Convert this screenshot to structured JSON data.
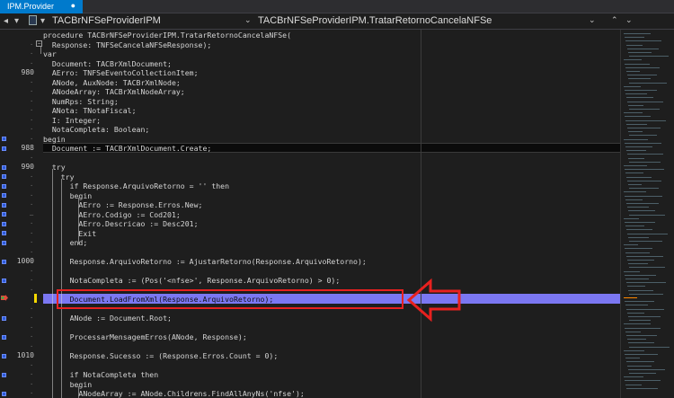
{
  "tab": {
    "title": "IPM.Provider",
    "close": "●"
  },
  "nav": {
    "left": "TACBrNFSeProviderIPM",
    "right": "TACBrNFSeProviderIPM.TratarRetornoCancelaNFSe"
  },
  "code_lines": [
    {
      "ln": "",
      "dot": "",
      "text": "procedure TACBrNFSeProviderIPM.TratarRetornoCancelaNFSe("
    },
    {
      "ln": "",
      "dot": "·",
      "text": "  Response: TNFSeCancelaNFSeResponse);"
    },
    {
      "ln": "",
      "dot": "·",
      "text": "var"
    },
    {
      "ln": "",
      "dot": "·",
      "text": "  Document: TACBrXmlDocument;"
    },
    {
      "ln": "980",
      "dot": "",
      "text": "  AErro: TNFSeEventoCollectionItem;"
    },
    {
      "ln": "",
      "dot": "·",
      "text": "  ANode, AuxNode: TACBrXmlNode;"
    },
    {
      "ln": "",
      "dot": "·",
      "text": "  ANodeArray: TACBrXmlNodeArray;"
    },
    {
      "ln": "",
      "dot": "·",
      "text": "  NumRps: String;"
    },
    {
      "ln": "",
      "dot": "·",
      "text": "  ANota: TNotaFiscal;"
    },
    {
      "ln": "",
      "dot": "·",
      "text": "  I: Integer;"
    },
    {
      "ln": "",
      "dot": "·",
      "text": "  NotaCompleta: Boolean;"
    },
    {
      "ln": "",
      "dot": "·",
      "text": "begin"
    },
    {
      "ln": "988",
      "dot": "",
      "text": "  Document := TACBrXmlDocument.Create;"
    },
    {
      "ln": "",
      "dot": "·",
      "text": ""
    },
    {
      "ln": "990",
      "dot": "",
      "text": "  try"
    },
    {
      "ln": "",
      "dot": "·",
      "text": "    try"
    },
    {
      "ln": "",
      "dot": "·",
      "text": "      if Response.ArquivoRetorno = '' then"
    },
    {
      "ln": "",
      "dot": "·",
      "text": "      begin"
    },
    {
      "ln": "",
      "dot": "·",
      "text": "        AErro := Response.Erros.New;"
    },
    {
      "ln": "",
      "dot": "–",
      "text": "        AErro.Codigo := Cod201;"
    },
    {
      "ln": "",
      "dot": "·",
      "text": "        AErro.Descricao := Desc201;"
    },
    {
      "ln": "",
      "dot": "·",
      "text": "        Exit"
    },
    {
      "ln": "",
      "dot": "·",
      "text": "      end;"
    },
    {
      "ln": "",
      "dot": "·",
      "text": ""
    },
    {
      "ln": "1000",
      "dot": "",
      "text": "      Response.ArquivoRetorno := AjustarRetorno(Response.ArquivoRetorno);"
    },
    {
      "ln": "",
      "dot": "·",
      "text": ""
    },
    {
      "ln": "",
      "dot": "·",
      "text": "      NotaCompleta := (Pos('<nfse>', Response.ArquivoRetorno) > 0);"
    },
    {
      "ln": "",
      "dot": "·",
      "text": ""
    },
    {
      "ln": "",
      "dot": "",
      "text": "      Document.LoadFromXml(Response.ArquivoRetorno);"
    },
    {
      "ln": "",
      "dot": "·",
      "text": ""
    },
    {
      "ln": "",
      "dot": "·",
      "text": "      ANode := Document.Root;"
    },
    {
      "ln": "",
      "dot": "·",
      "text": ""
    },
    {
      "ln": "",
      "dot": "·",
      "text": "      ProcessarMensagemErros(ANode, Response);"
    },
    {
      "ln": "",
      "dot": "·",
      "text": ""
    },
    {
      "ln": "1010",
      "dot": "",
      "text": "      Response.Sucesso := (Response.Erros.Count = 0);"
    },
    {
      "ln": "",
      "dot": "·",
      "text": ""
    },
    {
      "ln": "",
      "dot": "·",
      "text": "      if NotaCompleta then"
    },
    {
      "ln": "",
      "dot": "·",
      "text": "      begin"
    },
    {
      "ln": "",
      "dot": "·",
      "text": "        ANodeArray := ANode.Childrens.FindAllAnyNs('nfse');"
    }
  ],
  "colors": {
    "accent": "#007acc",
    "highlight": "#7b77f2",
    "annotation": "#e8211f"
  },
  "icons": {
    "back": "arrow-left-icon",
    "fwd": "arrow-right-icon",
    "unit": "unit-icon",
    "dropdown": "chevron-down-icon"
  }
}
